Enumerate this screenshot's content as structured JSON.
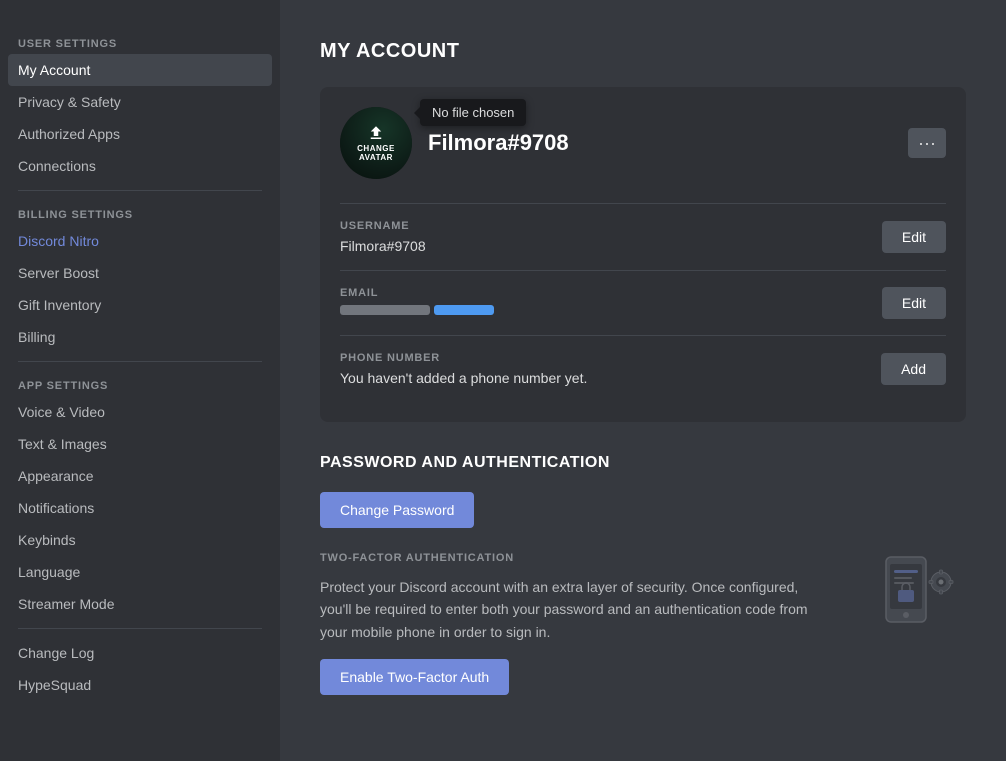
{
  "sidebar": {
    "user_settings_label": "User Settings",
    "billing_settings_label": "Billing Settings",
    "app_settings_label": "App Settings",
    "items": {
      "my_account": "My Account",
      "privacy_safety": "Privacy & Safety",
      "authorized_apps": "Authorized Apps",
      "connections": "Connections",
      "discord_nitro": "Discord Nitro",
      "server_boost": "Server Boost",
      "gift_inventory": "Gift Inventory",
      "billing": "Billing",
      "voice_video": "Voice & Video",
      "text_images": "Text & Images",
      "appearance": "Appearance",
      "notifications": "Notifications",
      "keybinds": "Keybinds",
      "language": "Language",
      "streamer_mode": "Streamer Mode",
      "change_log": "Change Log",
      "hypesquad": "HypeSquad"
    }
  },
  "main": {
    "page_title": "MY ACCOUNT",
    "profile": {
      "username": "Filmora#9708",
      "avatar_overlay_text": "CHANGE\nAVATAR",
      "no_file_tooltip": "No file chosen",
      "more_options_label": "···",
      "username_label": "USERNAME",
      "email_label": "EMAIL",
      "phone_label": "PHONE NUMBER",
      "phone_value": "You haven't added a phone number yet.",
      "edit_label": "Edit",
      "add_label": "Add"
    },
    "password_section": {
      "title": "PASSWORD AND AUTHENTICATION",
      "change_password_btn": "Change Password",
      "two_factor_label": "TWO-FACTOR AUTHENTICATION",
      "two_factor_desc": "Protect your Discord account with an extra layer of security. Once configured, you'll be required to enter both your password and an authentication code from your mobile phone in order to sign in.",
      "enable_2fa_btn": "Enable Two-Factor Auth"
    }
  }
}
